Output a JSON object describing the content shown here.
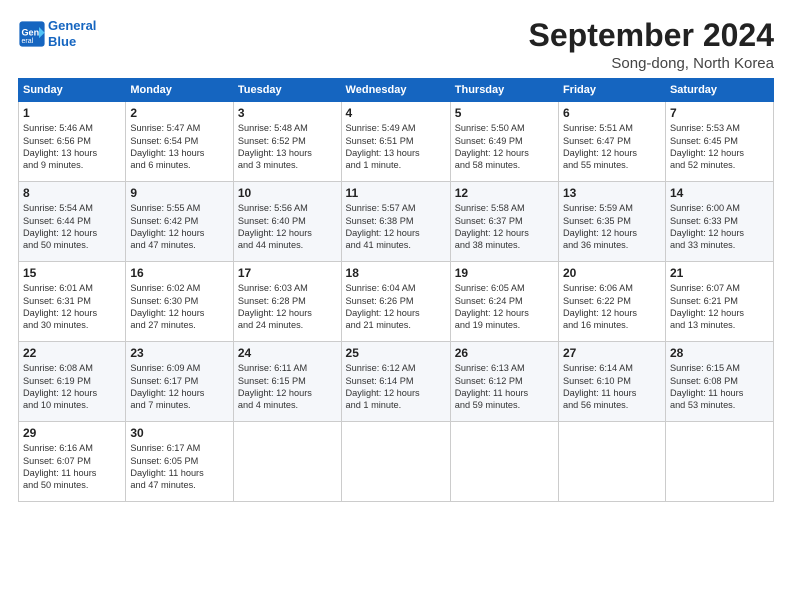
{
  "header": {
    "logo_line1": "General",
    "logo_line2": "Blue",
    "month_title": "September 2024",
    "location": "Song-dong, North Korea"
  },
  "days_of_week": [
    "Sunday",
    "Monday",
    "Tuesday",
    "Wednesday",
    "Thursday",
    "Friday",
    "Saturday"
  ],
  "weeks": [
    [
      {
        "num": "1",
        "info": "Sunrise: 5:46 AM\nSunset: 6:56 PM\nDaylight: 13 hours\nand 9 minutes."
      },
      {
        "num": "2",
        "info": "Sunrise: 5:47 AM\nSunset: 6:54 PM\nDaylight: 13 hours\nand 6 minutes."
      },
      {
        "num": "3",
        "info": "Sunrise: 5:48 AM\nSunset: 6:52 PM\nDaylight: 13 hours\nand 3 minutes."
      },
      {
        "num": "4",
        "info": "Sunrise: 5:49 AM\nSunset: 6:51 PM\nDaylight: 13 hours\nand 1 minute."
      },
      {
        "num": "5",
        "info": "Sunrise: 5:50 AM\nSunset: 6:49 PM\nDaylight: 12 hours\nand 58 minutes."
      },
      {
        "num": "6",
        "info": "Sunrise: 5:51 AM\nSunset: 6:47 PM\nDaylight: 12 hours\nand 55 minutes."
      },
      {
        "num": "7",
        "info": "Sunrise: 5:53 AM\nSunset: 6:45 PM\nDaylight: 12 hours\nand 52 minutes."
      }
    ],
    [
      {
        "num": "8",
        "info": "Sunrise: 5:54 AM\nSunset: 6:44 PM\nDaylight: 12 hours\nand 50 minutes."
      },
      {
        "num": "9",
        "info": "Sunrise: 5:55 AM\nSunset: 6:42 PM\nDaylight: 12 hours\nand 47 minutes."
      },
      {
        "num": "10",
        "info": "Sunrise: 5:56 AM\nSunset: 6:40 PM\nDaylight: 12 hours\nand 44 minutes."
      },
      {
        "num": "11",
        "info": "Sunrise: 5:57 AM\nSunset: 6:38 PM\nDaylight: 12 hours\nand 41 minutes."
      },
      {
        "num": "12",
        "info": "Sunrise: 5:58 AM\nSunset: 6:37 PM\nDaylight: 12 hours\nand 38 minutes."
      },
      {
        "num": "13",
        "info": "Sunrise: 5:59 AM\nSunset: 6:35 PM\nDaylight: 12 hours\nand 36 minutes."
      },
      {
        "num": "14",
        "info": "Sunrise: 6:00 AM\nSunset: 6:33 PM\nDaylight: 12 hours\nand 33 minutes."
      }
    ],
    [
      {
        "num": "15",
        "info": "Sunrise: 6:01 AM\nSunset: 6:31 PM\nDaylight: 12 hours\nand 30 minutes."
      },
      {
        "num": "16",
        "info": "Sunrise: 6:02 AM\nSunset: 6:30 PM\nDaylight: 12 hours\nand 27 minutes."
      },
      {
        "num": "17",
        "info": "Sunrise: 6:03 AM\nSunset: 6:28 PM\nDaylight: 12 hours\nand 24 minutes."
      },
      {
        "num": "18",
        "info": "Sunrise: 6:04 AM\nSunset: 6:26 PM\nDaylight: 12 hours\nand 21 minutes."
      },
      {
        "num": "19",
        "info": "Sunrise: 6:05 AM\nSunset: 6:24 PM\nDaylight: 12 hours\nand 19 minutes."
      },
      {
        "num": "20",
        "info": "Sunrise: 6:06 AM\nSunset: 6:22 PM\nDaylight: 12 hours\nand 16 minutes."
      },
      {
        "num": "21",
        "info": "Sunrise: 6:07 AM\nSunset: 6:21 PM\nDaylight: 12 hours\nand 13 minutes."
      }
    ],
    [
      {
        "num": "22",
        "info": "Sunrise: 6:08 AM\nSunset: 6:19 PM\nDaylight: 12 hours\nand 10 minutes."
      },
      {
        "num": "23",
        "info": "Sunrise: 6:09 AM\nSunset: 6:17 PM\nDaylight: 12 hours\nand 7 minutes."
      },
      {
        "num": "24",
        "info": "Sunrise: 6:11 AM\nSunset: 6:15 PM\nDaylight: 12 hours\nand 4 minutes."
      },
      {
        "num": "25",
        "info": "Sunrise: 6:12 AM\nSunset: 6:14 PM\nDaylight: 12 hours\nand 1 minute."
      },
      {
        "num": "26",
        "info": "Sunrise: 6:13 AM\nSunset: 6:12 PM\nDaylight: 11 hours\nand 59 minutes."
      },
      {
        "num": "27",
        "info": "Sunrise: 6:14 AM\nSunset: 6:10 PM\nDaylight: 11 hours\nand 56 minutes."
      },
      {
        "num": "28",
        "info": "Sunrise: 6:15 AM\nSunset: 6:08 PM\nDaylight: 11 hours\nand 53 minutes."
      }
    ],
    [
      {
        "num": "29",
        "info": "Sunrise: 6:16 AM\nSunset: 6:07 PM\nDaylight: 11 hours\nand 50 minutes."
      },
      {
        "num": "30",
        "info": "Sunrise: 6:17 AM\nSunset: 6:05 PM\nDaylight: 11 hours\nand 47 minutes."
      },
      {
        "num": "",
        "info": ""
      },
      {
        "num": "",
        "info": ""
      },
      {
        "num": "",
        "info": ""
      },
      {
        "num": "",
        "info": ""
      },
      {
        "num": "",
        "info": ""
      }
    ]
  ]
}
